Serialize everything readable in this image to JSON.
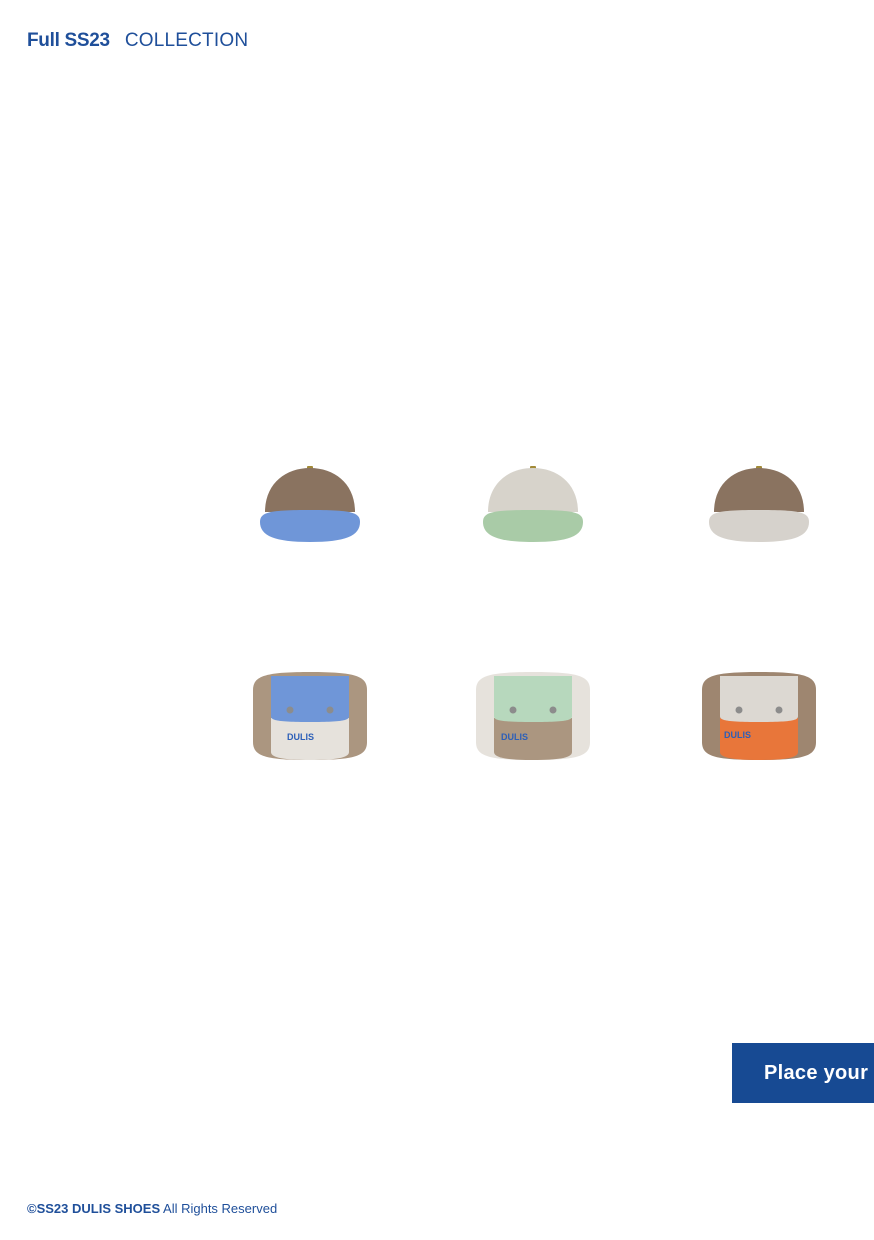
{
  "header": {
    "title_bold": "Full SS23",
    "title_light": "COLLECTION"
  },
  "products": [
    {
      "kind": "cap-side",
      "crown_color": "#8a7360",
      "brim_color": "#6f96d8",
      "icon": "cap-icon"
    },
    {
      "kind": "cap-side",
      "crown_color": "#d7d3cb",
      "brim_color": "#a9cba7",
      "icon": "cap-icon"
    },
    {
      "kind": "cap-side",
      "crown_color": "#8a7360",
      "brim_color": "#d6d2cc",
      "icon": "cap-icon"
    },
    {
      "kind": "cap-front",
      "crown_color": "#ab9680",
      "pocket_color": "#6f96d8",
      "panel_color": "#e6e2dc",
      "brand": "DULIS",
      "icon": "pocket-cap-icon"
    },
    {
      "kind": "cap-front",
      "crown_color": "#e6e2dc",
      "pocket_color": "#b7d8bd",
      "panel_color": "#ab9680",
      "brand": "DULIS",
      "icon": "pocket-cap-icon"
    },
    {
      "kind": "cap-front",
      "crown_color": "#9e8670",
      "pocket_color": "#dcd8d2",
      "panel_color": "#e8763a",
      "brand": "DULIS",
      "icon": "pocket-cap-icon"
    }
  ],
  "cta": {
    "label": "Place your"
  },
  "footer": {
    "brand": "©SS23 DULIS SHOES",
    "rights": " All Rights Reserved"
  },
  "colors": {
    "brand_blue": "#174a93",
    "text_blue": "#1f4f9a"
  }
}
